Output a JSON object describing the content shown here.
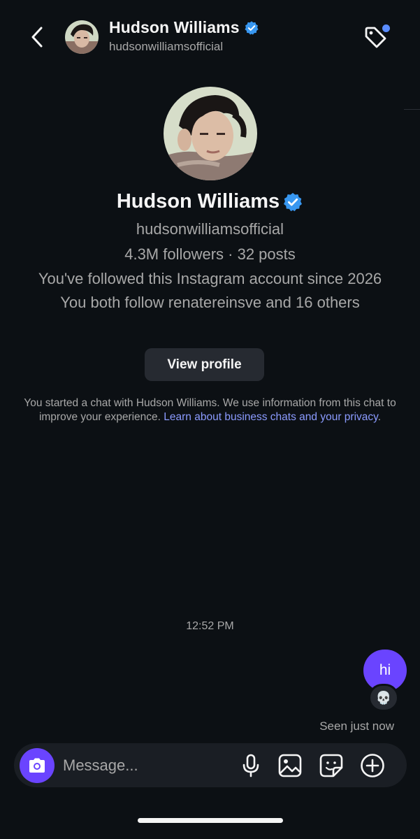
{
  "header": {
    "name": "Hudson Williams",
    "handle": "hudsonwilliamsofficial",
    "back_icon": "chevron-left-icon",
    "tag_icon": "tag-icon",
    "verified_icon": "verified-badge-icon"
  },
  "profile": {
    "name": "Hudson Williams",
    "handle": "hudsonwilliamsofficial",
    "stats": "4.3M followers · 32 posts",
    "followed_since": "You've followed this Instagram account since 2026",
    "mutual": "You both follow renatereinsve and 16 others",
    "view_profile_label": "View profile"
  },
  "disclaimer": {
    "text": "You started a chat with Hudson Williams. We use information from this chat to improve your experience. ",
    "link": "Learn about business chats and your privacy",
    "suffix": "."
  },
  "messages": {
    "timestamp": "12:52 PM",
    "items": [
      {
        "text": "hi",
        "sender": "me",
        "reaction": "💀"
      }
    ],
    "seen": "Seen just now"
  },
  "composer": {
    "placeholder": "Message...",
    "icons": [
      "camera-icon",
      "microphone-icon",
      "gallery-icon",
      "sticker-icon",
      "plus-icon"
    ]
  },
  "colors": {
    "background": "#0c1014",
    "accent": "#6a44ff",
    "verified": "#3897f0",
    "link": "#8b9bff"
  }
}
